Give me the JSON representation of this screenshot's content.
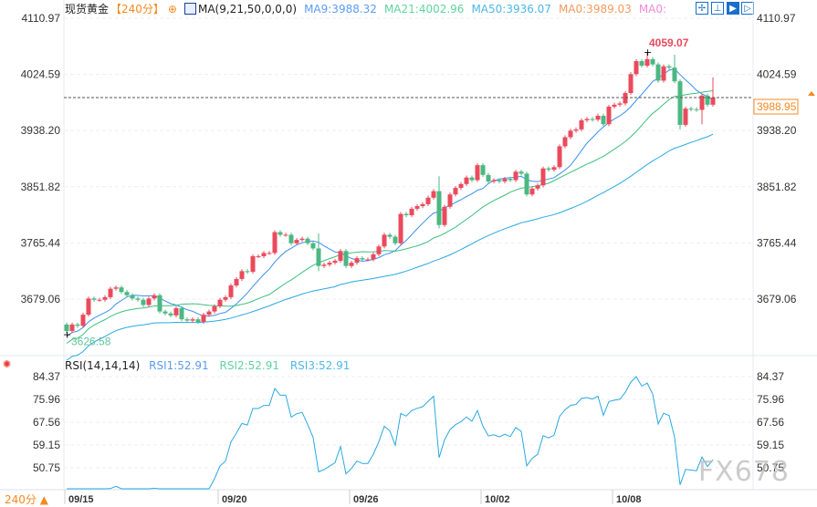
{
  "header": {
    "symbol": "现货黄金",
    "period": "【240分】",
    "ma_params": "MA(9,21,50,0,0,0)",
    "ma9": "MA9:3988.32",
    "ma21": "MA21:4002.96",
    "ma50": "MA50:3936.07",
    "ma0a": "MA0:3989.03",
    "ma0b": "MA0:"
  },
  "toolbar": {
    "icons": [
      "crosshair-icon",
      "zoom-range-icon",
      "play-icon",
      "end-icon"
    ]
  },
  "rsi_header": {
    "params": "RSI(14,14,14)",
    "rsi1": "RSI1:52.91",
    "rsi2": "RSI2:52.91",
    "rsi3": "RSI3:52.91"
  },
  "footer": {
    "period": "240分 ▲",
    "watermark": "FX678"
  },
  "colors": {
    "up": "#eb4a5c",
    "down": "#4cb782",
    "ma9": "#3a8ff0",
    "ma21": "#3cc07e",
    "ma50": "#29a9e1",
    "rsi": "#29a9e1",
    "accent": "#f5891f"
  },
  "chart_data": {
    "type": "candlestick",
    "price_ticks": [
      "4110.97",
      "4024.59",
      "3938.20",
      "3851.82",
      "3765.44",
      "3679.06"
    ],
    "price_range": [
      3605,
      4125
    ],
    "rsi_ticks": [
      "84.37",
      "75.96",
      "67.56",
      "59.15",
      "50.75"
    ],
    "rsi_range": [
      43,
      86
    ],
    "date_labels": [
      {
        "label": "09/15",
        "index": 0
      },
      {
        "label": "09/20",
        "index": 28
      },
      {
        "label": "09/26",
        "index": 52
      },
      {
        "label": "10/02",
        "index": 76
      },
      {
        "label": "10/08",
        "index": 100
      }
    ],
    "last_price": "3988.95",
    "annotations": {
      "high": "4059.07",
      "high_index": 106,
      "low": "3626.58",
      "low_index": 0
    },
    "closes": [
      3630,
      3640,
      3638,
      3655,
      3680,
      3678,
      3678,
      3682,
      3695,
      3697,
      3690,
      3685,
      3680,
      3678,
      3670,
      3680,
      3685,
      3660,
      3657,
      3654,
      3665,
      3648,
      3646,
      3648,
      3644,
      3655,
      3660,
      3668,
      3678,
      3682,
      3700,
      3710,
      3722,
      3721,
      3745,
      3745,
      3750,
      3750,
      3782,
      3778,
      3778,
      3765,
      3770,
      3772,
      3765,
      3757,
      3730,
      3732,
      3735,
      3738,
      3753,
      3730,
      3735,
      3742,
      3740,
      3740,
      3748,
      3760,
      3778,
      3775,
      3765,
      3810,
      3808,
      3818,
      3822,
      3825,
      3835,
      3845,
      3793,
      3821,
      3840,
      3850,
      3856,
      3866,
      3862,
      3885,
      3870,
      3860,
      3862,
      3860,
      3864,
      3862,
      3875,
      3872,
      3840,
      3849,
      3854,
      3880,
      3878,
      3882,
      3914,
      3928,
      3938,
      3940,
      3954,
      3956,
      3955,
      3961,
      3948,
      3975,
      3978,
      3980,
      3996,
      4025,
      4045,
      4038,
      4048,
      4040,
      4015,
      4037,
      4035,
      4014,
      3947,
      3972,
      3971,
      3970,
      3992,
      3978,
      3989
    ],
    "first_open": 3640,
    "wick_extremes": {
      "0": {
        "l": 3626.58
      },
      "46": {
        "h": 3780,
        "l": 3722
      },
      "68": {
        "h": 3868,
        "l": 3788
      },
      "106": {
        "h": 4059.07
      },
      "111": {
        "h": 4055
      },
      "112": {
        "l": 3940
      },
      "116": {
        "l": 3948
      },
      "118": {
        "h": 4020
      }
    }
  }
}
